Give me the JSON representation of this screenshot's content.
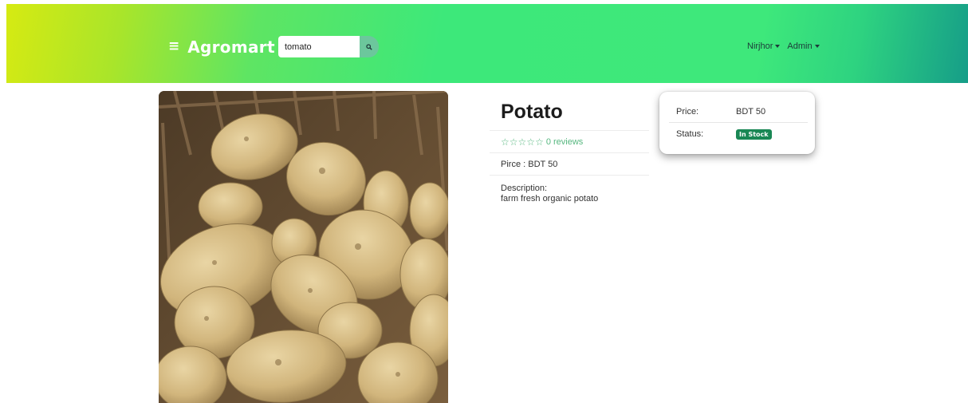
{
  "navbar": {
    "menu_icon": "hamburger-icon",
    "brand": "Agromart",
    "search": {
      "value": "tomato",
      "icon": "search-icon"
    },
    "user_menu": "Nirjhor",
    "admin_menu": "Admin"
  },
  "product": {
    "image_alt": "potato-photo",
    "name": "Potato",
    "rating": {
      "stars": 0,
      "max_stars": 5,
      "reviews_text": "0 reviews"
    },
    "price_line": "Pirce : BDT 50",
    "description_label": "Description:",
    "description": "farm fresh organic potato"
  },
  "summary_card": {
    "price_label": "Price:",
    "price_value": "BDT 50",
    "status_label": "Status:",
    "status_value": "In Stock"
  },
  "colors": {
    "accent_green": "#56b77f",
    "badge_green": "#198754"
  }
}
